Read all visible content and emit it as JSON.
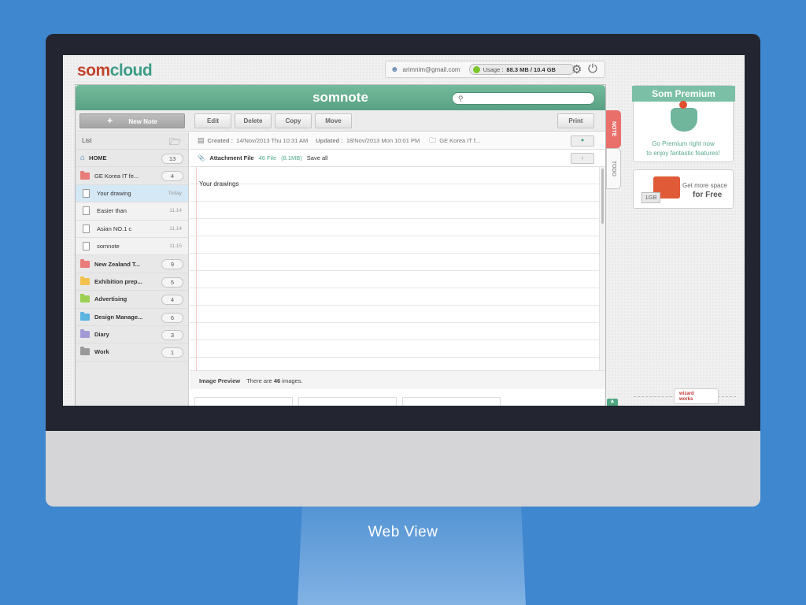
{
  "header": {
    "logo_part1": "som",
    "logo_part2": "cloud",
    "email": "arimnim@gmail.com",
    "usage_label": "Usage :",
    "usage_value": "88.3 MB / 10.4 GB",
    "settings_icon": "gear-icon",
    "power_icon": "power-icon"
  },
  "app": {
    "brand": "somnote",
    "search_placeholder": ""
  },
  "toolbar": {
    "new_note": "New Note",
    "edit": "Edit",
    "delete": "Delete",
    "copy": "Copy",
    "move": "Move",
    "print": "Print"
  },
  "sidebar": {
    "title": "List",
    "folders": [
      {
        "label": "HOME",
        "count": "13",
        "color": "#5b9fd6"
      },
      {
        "label": "GE Korea IT fe...",
        "count": "4",
        "color": "#e87c78"
      },
      {
        "label": "New Zealand T...",
        "count": "9",
        "color": "#e87c78"
      },
      {
        "label": "Exhibition prep...",
        "count": "5",
        "color": "#f2c24f"
      },
      {
        "label": "Advertising",
        "count": "4",
        "color": "#9bcf52"
      },
      {
        "label": "Design Manage...",
        "count": "6",
        "color": "#5bb3e0"
      },
      {
        "label": "Diary",
        "count": "3",
        "color": "#a29ad4"
      },
      {
        "label": "Work",
        "count": "1",
        "color": "#9a9a9a"
      }
    ],
    "notes": [
      {
        "label": "Your drawing",
        "date": "Today"
      },
      {
        "label": "Easier than",
        "date": "11.14"
      },
      {
        "label": "Asian NO.1 c",
        "date": "11.14"
      },
      {
        "label": "somnote",
        "date": "11.15"
      }
    ]
  },
  "note": {
    "created_label": "Created :",
    "created": "14/Nov/2013 Thu 10:31 AM",
    "updated_label": "Updated :",
    "updated": "18/Nov/2013 Mon 10:01 PM",
    "folder": "GE Korea IT f...",
    "attachment_label": "Attachment File",
    "attachment_count": "46 File",
    "attachment_size": "(8.1MB)",
    "save_all": "Save all",
    "text": "Your drawings",
    "preview_label": "Image Preview",
    "preview_text_a": "There are",
    "preview_count": "46",
    "preview_text_b": "images."
  },
  "tabs": {
    "note": "NOTE",
    "todo": "TODO"
  },
  "promos": {
    "premium_title": "Som Premium",
    "premium_line1": "Go Premium right now",
    "premium_line2": "to enjoy fantastic features!",
    "space_badge": "1GB",
    "space_line1": "Get more space",
    "space_line2": "for Free",
    "wizard_line1": "wizard",
    "wizard_line2": "works"
  },
  "caption": "Web View"
}
